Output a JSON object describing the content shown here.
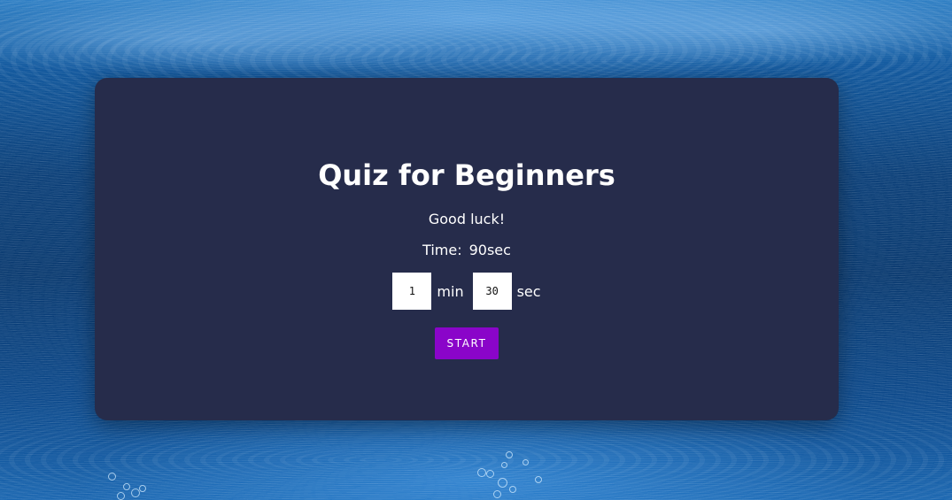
{
  "quiz": {
    "title": "Quiz for Beginners",
    "subtitle": "Good luck!",
    "time_label": "Time:",
    "time_value": "90sec",
    "minutes_value": "1",
    "minutes_unit": "min",
    "seconds_value": "30",
    "seconds_unit": "sec",
    "start_label": "START"
  },
  "colors": {
    "card_background": "#262c4b",
    "accent": "#8a05c9",
    "text": "#ffffff"
  }
}
